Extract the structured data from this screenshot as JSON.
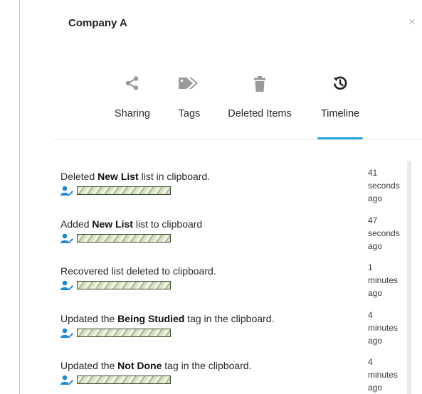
{
  "panel": {
    "title": "Company A",
    "close_label": "×"
  },
  "tabs": [
    {
      "label": "Sharing",
      "icon": "share-icon",
      "active": false
    },
    {
      "label": "Tags",
      "icon": "tag-icon",
      "active": false
    },
    {
      "label": "Deleted Items",
      "icon": "trash-icon",
      "active": false
    },
    {
      "label": "Timeline",
      "icon": "history-icon",
      "active": true
    }
  ],
  "colors": {
    "accent": "#2aa8e0",
    "icon_gray": "#9a9a9a",
    "user_icon_blue": "#1e88d8"
  },
  "timeline": [
    {
      "pre": "Deleted ",
      "bold": "New List",
      "post": " list in clipboard.",
      "time": [
        "41",
        "seconds",
        "ago"
      ]
    },
    {
      "pre": "Added ",
      "bold": "New List",
      "post": " list to clipboard",
      "time": [
        "47",
        "seconds",
        "ago"
      ]
    },
    {
      "pre": "Recovered list deleted to clipboard.",
      "bold": "",
      "post": "",
      "time": [
        "1",
        "minutes",
        "ago"
      ]
    },
    {
      "pre": "Updated the ",
      "bold": "Being Studied",
      "post": " tag in the clipboard.",
      "time": [
        "4",
        "minutes",
        "ago"
      ]
    },
    {
      "pre": "Updated the ",
      "bold": "Not Done",
      "post": " tag in the clipboard.",
      "time": [
        "4",
        "minutes",
        "ago"
      ]
    }
  ]
}
